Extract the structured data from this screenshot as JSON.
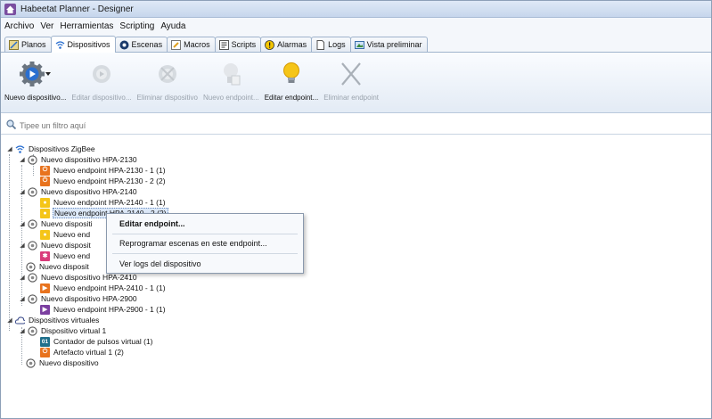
{
  "window": {
    "title": "Habeetat Planner - Designer"
  },
  "menubar": {
    "items": [
      "Archivo",
      "Ver",
      "Herramientas",
      "Scripting",
      "Ayuda"
    ]
  },
  "tabs": [
    {
      "label": "Planos",
      "icon": "blueprint-icon"
    },
    {
      "label": "Dispositivos",
      "icon": "wifi-icon",
      "active": true
    },
    {
      "label": "Escenas",
      "icon": "scenes-icon"
    },
    {
      "label": "Macros",
      "icon": "macro-icon"
    },
    {
      "label": "Scripts",
      "icon": "script-icon"
    },
    {
      "label": "Alarmas",
      "icon": "alarm-icon"
    },
    {
      "label": "Logs",
      "icon": "log-icon"
    },
    {
      "label": "Vista preliminar",
      "icon": "preview-icon"
    }
  ],
  "ribbon": {
    "new_device": "Nuevo dispositivo...",
    "edit_device": "Editar dispositivo...",
    "delete_device": "Eliminar dispositivo",
    "new_endpoint": "Nuevo endpoint...",
    "edit_endpoint": "Editar endpoint...",
    "delete_endpoint": "Eliminar endpoint"
  },
  "filter": {
    "placeholder": "Tipee un filtro aquí"
  },
  "tree": {
    "zigbee": "Dispositivos ZigBee",
    "dev2130": "Nuevo dispositivo HPA-2130",
    "ep2130_1": "Nuevo endpoint HPA-2130 - 1 (1)",
    "ep2130_2": "Nuevo endpoint HPA-2130 - 2 (2)",
    "dev2140": "Nuevo dispositivo HPA-2140",
    "ep2140_1": "Nuevo endpoint HPA-2140 - 1 (1)",
    "ep2140_2": "Nuevo endpoint HPA-2140 - 2 (2)",
    "devA": "Nuevo dispositi",
    "epA": "Nuevo end",
    "devB": "Nuevo disposit",
    "epB": "Nuevo end",
    "devC": "Nuevo disposit",
    "dev2410": "Nuevo dispositivo HPA-2410",
    "ep2410_1": "Nuevo endpoint HPA-2410 - 1 (1)",
    "dev2900": "Nuevo dispositivo HPA-2900",
    "ep2900_1": "Nuevo endpoint HPA-2900 - 1 (1)",
    "virtual": "Dispositivos virtuales",
    "vdev1": "Dispositivo virtual 1",
    "vcounter": "Contador de pulsos virtual (1)",
    "vcounter_badge": "01",
    "vartifact": "Artefacto virtual 1 (2)",
    "vnewdev": "Nuevo dispositivo"
  },
  "context_menu": {
    "edit": "Editar endpoint...",
    "reprogram": "Reprogramar escenas en este endpoint...",
    "logs": "Ver logs del dispositivo"
  },
  "colors": {
    "orange_power": "#e8731e",
    "yellow_bulb": "#f5c518",
    "pink_alarm": "#d93a7a",
    "purple_play": "#7b3fa0",
    "teal_counter": "#1f6f8b",
    "blue_accent": "#2a6fd0"
  }
}
